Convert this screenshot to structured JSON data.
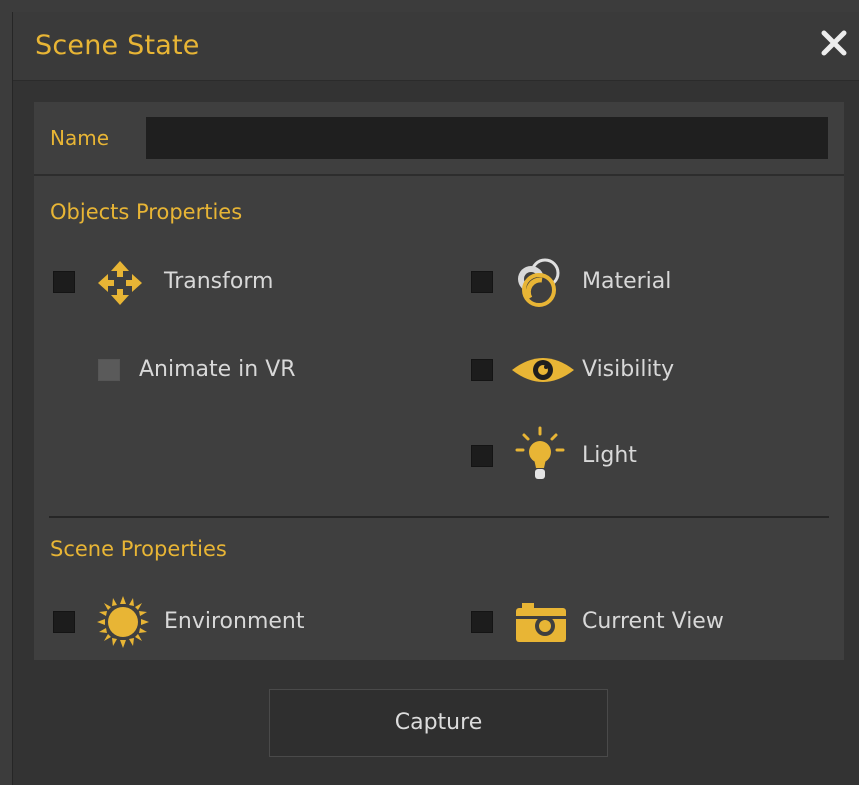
{
  "dialog": {
    "title": "Scene State",
    "close_icon": "close-icon",
    "accent_color": "#e8b535"
  },
  "name_field": {
    "label": "Name",
    "value": "",
    "placeholder": ""
  },
  "objects_properties": {
    "title": "Objects Properties",
    "items": [
      {
        "label": "Transform",
        "icon": "move-arrows-icon",
        "checked": false
      },
      {
        "label": "Material",
        "icon": "material-spheres-icon",
        "checked": false
      },
      {
        "label": "Animate in VR",
        "icon": "",
        "checked": false,
        "disabled": true
      },
      {
        "label": "Visibility",
        "icon": "eye-icon",
        "checked": false
      },
      {
        "label": "Light",
        "icon": "lightbulb-icon",
        "checked": false
      }
    ]
  },
  "scene_properties": {
    "title": "Scene Properties",
    "items": [
      {
        "label": "Environment",
        "icon": "sun-icon",
        "checked": false
      },
      {
        "label": "Current View",
        "icon": "camera-icon",
        "checked": false
      }
    ]
  },
  "actions": {
    "capture_label": "Capture"
  }
}
